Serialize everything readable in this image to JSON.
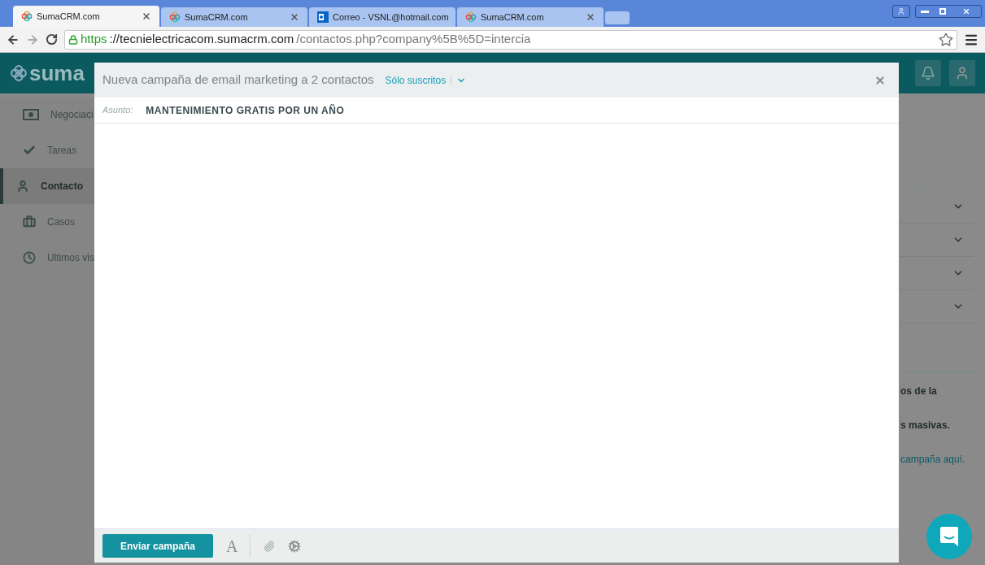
{
  "browser": {
    "tabs": [
      {
        "title": "SumaCRM.com",
        "kind": "suma",
        "selected": true
      },
      {
        "title": "SumaCRM.com",
        "kind": "suma",
        "selected": false
      },
      {
        "title": "Correo - VSNL@hotmail.com",
        "kind": "mail",
        "selected": false
      },
      {
        "title": "SumaCRM.com",
        "kind": "suma",
        "selected": false
      }
    ],
    "url_scheme": "https",
    "url_host": "://tecnielectricacom.sumacrm.com",
    "url_path": "/contactos.php?company%5B%5D=intercia"
  },
  "app": {
    "logo": "suma",
    "sidebar": [
      {
        "label": "Negociaci",
        "kind": "money",
        "selected": false
      },
      {
        "label": "Tareas",
        "kind": "check",
        "selected": false
      },
      {
        "label": "Contacto",
        "kind": "person",
        "selected": true
      },
      {
        "label": "Casos",
        "kind": "briefcase",
        "selected": false
      },
      {
        "label": "Ultimos vis",
        "kind": "clock",
        "selected": false
      }
    ],
    "accordion_rows": [
      {
        "expanded": false
      },
      {
        "expanded": false
      },
      {
        "expanded": false
      },
      {
        "expanded": false
      }
    ],
    "info_lines": [
      {
        "kind": "bold",
        "text": "os de la"
      },
      {
        "kind": "bold",
        "text": "**s masivas**."
      },
      {
        "kind": "link",
        "text": "campaña aquí."
      }
    ]
  },
  "modal": {
    "title": "Nueva campaña de email marketing a 2 contactos",
    "filter": "Sólo suscritos",
    "subject_label": "Asunto:",
    "subject": "MANTENIMIENTO GRATIS POR UN AÑO",
    "send_button": "Enviar campaña",
    "format_button": "A"
  }
}
